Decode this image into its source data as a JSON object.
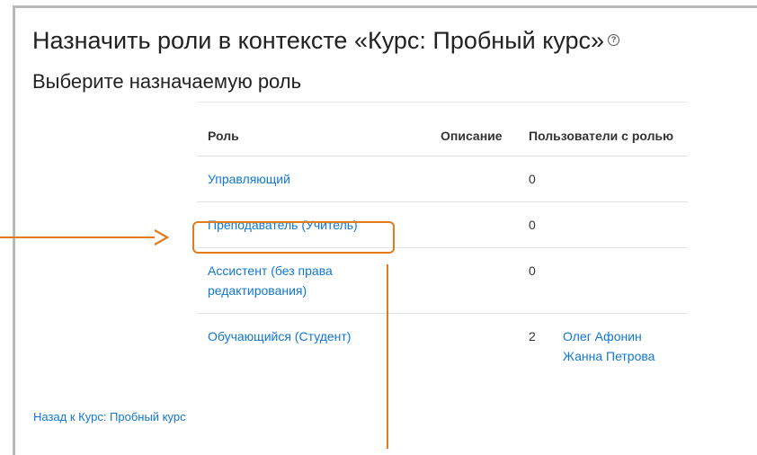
{
  "page": {
    "title": "Назначить роли в контексте «Курс: Пробный курс»",
    "help_icon": "question-circle-icon",
    "subtitle": "Выберите назначаемую роль"
  },
  "table": {
    "headers": {
      "role": "Роль",
      "description": "Описание",
      "users": "Пользователи с ролью"
    },
    "rows": [
      {
        "role": "Управляющий",
        "description": "",
        "count": "0",
        "users": []
      },
      {
        "role": "Преподаватель (Учитель)",
        "description": "",
        "count": "0",
        "users": []
      },
      {
        "role": "Ассистент (без права редактирования)",
        "description": "",
        "count": "0",
        "users": []
      },
      {
        "role": "Обучающийся (Студент)",
        "description": "",
        "count": "2",
        "users": [
          "Олег Афонин",
          "Жанна Петрова"
        ]
      }
    ]
  },
  "back_link": "Назад к Курс: Пробный курс",
  "colors": {
    "link": "#1177d1",
    "annotation": "#e07b1f"
  }
}
